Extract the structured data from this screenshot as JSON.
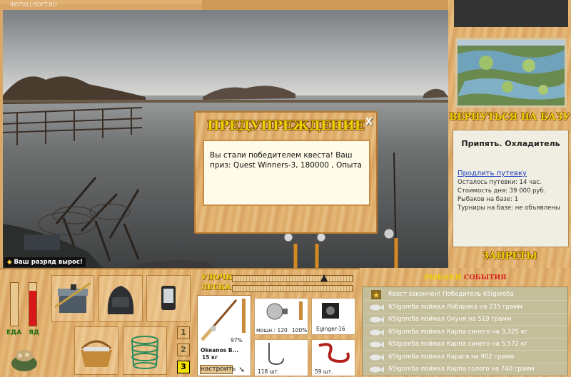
{
  "watermark": "INSTALLSOFT.RU",
  "rank_message": "Ваш разряд вырос!",
  "dialog": {
    "title": "ПРЕДУПРЕЖДЕНИЕ",
    "close_label": "X",
    "message": "Вы стали победителем квеста! Ваш приз: Quest Winners-3, 180000 , Опыта"
  },
  "sidebar": {
    "back_label": "ВЕРНУТЬСЯ НА БАЗУ",
    "location": "Припять. Охладитель",
    "extend_link": "Продлить путевку",
    "lines": [
      "Осталось путевки: 14 час.",
      "Стоимость дня: 39 000 руб.",
      "Рыбаков на базе: 1",
      "Турниры на базе: не объявлены"
    ],
    "bans_label": "ЗАПРЕТЫ"
  },
  "meters": {
    "food_label": "ЕДА",
    "hp_label": "ЯД",
    "food_level": 0,
    "hp_level": 0.82
  },
  "tackle": {
    "line_label": "УДОЧКА",
    "leash_label": "ЛЕСКА",
    "rod_name": "Okeanos B...",
    "rod_weight": "15 кг",
    "rod_percent": "97%",
    "setup_button": "настроить",
    "reel_power": "мощн.: 120",
    "reel_percent": "100%",
    "line_name": "Eginger-16",
    "hooks_count": "118 шт.",
    "bait_count": "59 шт.",
    "line_tension": 0.73
  },
  "slots": [
    "1",
    "2",
    "3"
  ],
  "active_slot": "3",
  "events": {
    "tab_fishers": "РЫБАКИ",
    "tab_events": "СОБЫТИЯ",
    "accent_events": "#d82020",
    "accent_fishers": "#f0d200",
    "items": [
      {
        "icon": "star-icon",
        "text": "Квест закончен! Победитель 65Igoreба"
      },
      {
        "icon": "fish-icon",
        "text": "65Igoreба поймал Лобарика на 235 грамм"
      },
      {
        "icon": "fish-icon",
        "text": "65Igoreба поймал Окуня на 519 грамм"
      },
      {
        "icon": "fish-icon",
        "text": "65Igoreба поймал Карпа синего на 3,325 кг"
      },
      {
        "icon": "fish-icon",
        "text": "65Igoreба поймал Карпа синего на 5,572 кг"
      },
      {
        "icon": "fish-icon",
        "text": "65Igoreба поймал Карася на 902 грамм"
      },
      {
        "icon": "fish-icon",
        "text": "65Igoreба поймал Карпа голого на 740 грамм"
      }
    ]
  }
}
